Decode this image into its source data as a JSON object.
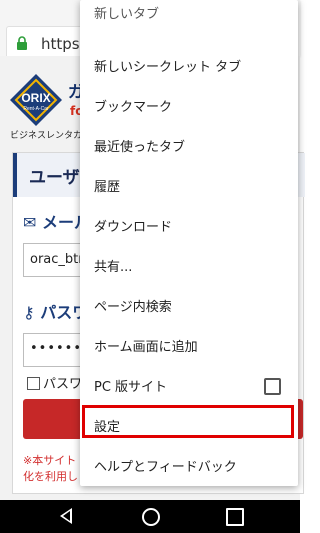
{
  "browser": {
    "url_text": "https://"
  },
  "page": {
    "brand_text": "ガ",
    "brand_sub": "fo",
    "tagline": "ビジネスレンタカー",
    "logo_text": "ORIX",
    "logo_subtext": "Rent-A-Car",
    "card_title": "ユーザー",
    "mail_label": "メール",
    "mail_value": "orac_btm",
    "pass_label": "パスワ",
    "pass_value": "•••••••",
    "show_pass_label": "パスワ",
    "note": "※本サイト\n化を利用し"
  },
  "menu": {
    "items": [
      {
        "label": "新しいタブ"
      },
      {
        "label": "新しいシークレット タブ"
      },
      {
        "label": "ブックマーク"
      },
      {
        "label": "最近使ったタブ"
      },
      {
        "label": "履歴"
      },
      {
        "label": "ダウンロード"
      },
      {
        "label": "共有..."
      },
      {
        "label": "ページ内検索"
      },
      {
        "label": "ホーム画面に追加"
      },
      {
        "label": "PC 版サイト"
      },
      {
        "label": "設定"
      },
      {
        "label": "ヘルプとフィードバック"
      }
    ]
  },
  "colors": {
    "highlight": "#e00000",
    "brand_blue": "#1c3d7a",
    "login_red": "#c62828"
  }
}
